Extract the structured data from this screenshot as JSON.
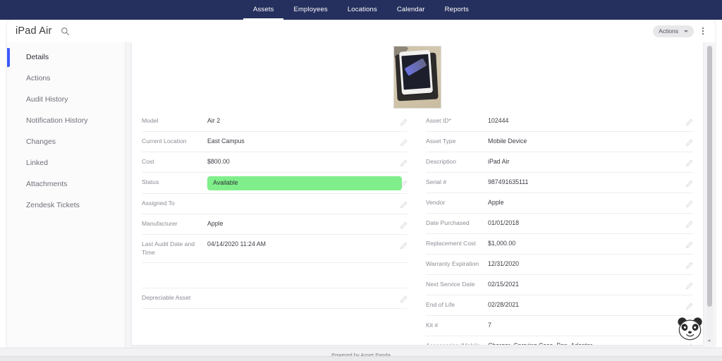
{
  "topnav": {
    "items": [
      {
        "label": "Assets",
        "active": true
      },
      {
        "label": "Employees",
        "active": false
      },
      {
        "label": "Locations",
        "active": false
      },
      {
        "label": "Calendar",
        "active": false
      },
      {
        "label": "Reports",
        "active": false
      }
    ],
    "background_color": "#26305e"
  },
  "header": {
    "asset_title": "iPad Air",
    "search_icon": "search-icon",
    "actions_label": "Actions",
    "kebab_icon": "more-vertical-icon"
  },
  "sidebar": {
    "items": [
      {
        "label": "Details",
        "active": true
      },
      {
        "label": "Actions",
        "active": false
      },
      {
        "label": "Audit History",
        "active": false
      },
      {
        "label": "Notification History",
        "active": false
      },
      {
        "label": "Changes",
        "active": false
      },
      {
        "label": "Linked",
        "active": false
      },
      {
        "label": "Attachments",
        "active": false
      },
      {
        "label": "Zendesk Tickets",
        "active": false
      }
    ],
    "active_accent_color": "#3d5afe"
  },
  "thumbnail": {
    "alt": "asset-photo-ipad-on-desk"
  },
  "details": {
    "left_fields": [
      {
        "label": "Model",
        "value": "Air 2",
        "highlight": false
      },
      {
        "label": "Current Location",
        "value": "East Campus",
        "highlight": false
      },
      {
        "label": "Cost",
        "value": "$800.00",
        "highlight": false
      },
      {
        "label": "Status",
        "value": "Available",
        "highlight": true
      },
      {
        "label": "Assigned To",
        "value": "",
        "highlight": false
      },
      {
        "label": "Manufacturer",
        "value": "Apple",
        "highlight": false
      },
      {
        "label": "Last Audit Date and Time",
        "value": "04/14/2020 11:24 AM",
        "highlight": false
      },
      {
        "label": "",
        "value": "",
        "highlight": false
      },
      {
        "label": "Depreciable Asset",
        "value": "",
        "highlight": false
      }
    ],
    "right_fields": [
      {
        "label": "Asset ID*",
        "value": "102444"
      },
      {
        "label": "Asset Type",
        "value": "Mobile Device"
      },
      {
        "label": "Description",
        "value": "iPad Air"
      },
      {
        "label": "Serial #",
        "value": "987491635111"
      },
      {
        "label": "Vendor",
        "value": "Apple"
      },
      {
        "label": "Date Purchased",
        "value": "01/01/2018"
      },
      {
        "label": "Replacement Cost",
        "value": "$1,000.00"
      },
      {
        "label": "Warranty Expiration",
        "value": "12/31/2020"
      },
      {
        "label": "Next Service Date",
        "value": "02/15/2021"
      },
      {
        "label": "End of Life",
        "value": "02/28/2021"
      },
      {
        "label": "Kit #",
        "value": "7"
      },
      {
        "label": "Accessories (Mobile Device)",
        "value": "Charger, Carrying Case, Pen, Adapter"
      }
    ],
    "status_highlight_color": "#80ef8b",
    "edit_icon": "pencil-icon"
  },
  "chat_widget": {
    "icon": "panda-mascot-icon"
  },
  "footer": {
    "text": "Powered by Asset Panda"
  }
}
